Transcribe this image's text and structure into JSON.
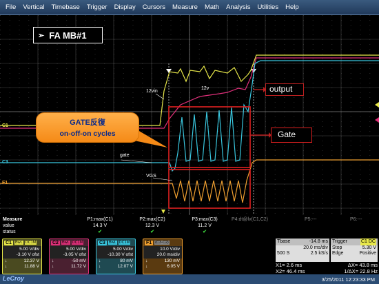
{
  "menu": [
    "File",
    "Vertical",
    "Timebase",
    "Trigger",
    "Display",
    "Cursors",
    "Measure",
    "Math",
    "Analysis",
    "Utilities",
    "Help"
  ],
  "screen": {
    "title": "FA MB#1",
    "title_arrow": "➢",
    "callout_line1": "GATE反復",
    "callout_line2": "on-off-on cycles",
    "output_label": "output",
    "gate_label": "Gate",
    "labels": {
      "v12in": "12vin",
      "v12v": "12v",
      "gate": "gate",
      "vgs": "VGS"
    },
    "markers": {
      "c1": "C1",
      "c3": "C3",
      "f1": "F1"
    },
    "colors": {
      "c1": "#e8e84a",
      "c2": "#e0307a",
      "c3": "#3ac8e0",
      "f1": "#f0a030",
      "highlight": "#e02020"
    }
  },
  "measure": {
    "row_labels": [
      "Measure",
      "value",
      "status"
    ],
    "params": [
      {
        "name": "P1:max(C1)",
        "value": "14.3 V",
        "status": "✔"
      },
      {
        "name": "P2:max(C2)",
        "value": "12.3 V",
        "status": "✔"
      },
      {
        "name": "P3:max(C3)",
        "value": "11.2 V",
        "status": "✔"
      },
      {
        "name": "P4:dt@lv(C1,C2)",
        "value": "",
        "status": ""
      },
      {
        "name": "P5:---",
        "value": "",
        "status": ""
      },
      {
        "name": "P6:---",
        "value": "",
        "status": ""
      }
    ]
  },
  "channels": [
    {
      "tag": "C1",
      "opt1": "BwL",
      "opt2": "DC1M",
      "vdiv": "5.00 V/div",
      "ofst": "-3.10 V ofst",
      "v1": "12.37 V",
      "v2": "11.88 V",
      "color": "#e8e84a"
    },
    {
      "tag": "C2",
      "opt1": "BwL",
      "opt2": "DC1M",
      "vdiv": "5.00 V/div",
      "ofst": "-3.05 V ofst",
      "v1": "-50 mV",
      "v2": "11.72 V",
      "color": "#e0307a"
    },
    {
      "tag": "C3",
      "opt1": "BwL",
      "opt2": "DC1M",
      "vdiv": "5.00 V/div",
      "ofst": "-10.30 V ofst",
      "v1": "80 mV",
      "v2": "12.07 V",
      "color": "#3ac8e0"
    },
    {
      "tag": "F1",
      "opt1": "",
      "opt2": "(C3-C2)",
      "vdiv": "10.0 V/div",
      "ofst": "20.0 ms/div",
      "v1": "130 mV",
      "v2": "6.05 V",
      "color": "#f0a030"
    }
  ],
  "timebase": {
    "label": "Tbase",
    "delay": "-14.8 ms",
    "rate1": "20.0 ms/div",
    "samples": "500 S",
    "rate2": "2.5 kS/s"
  },
  "trigger": {
    "label": "Trigger",
    "src": "C1 DC",
    "mode": "Stop",
    "level": "5.30 V",
    "type": "Edge",
    "slope": "Positive"
  },
  "cursors": {
    "x1": "X1= 2.6 ms",
    "dx": "ΔX= 43.8 ms",
    "x2": "X2= 46.4 ms",
    "inv": "1/ΔX= 22.8 Hz"
  },
  "footer": {
    "brand": "LeCroy",
    "timestamp": "3/25/2011 12:23:33 PM"
  }
}
